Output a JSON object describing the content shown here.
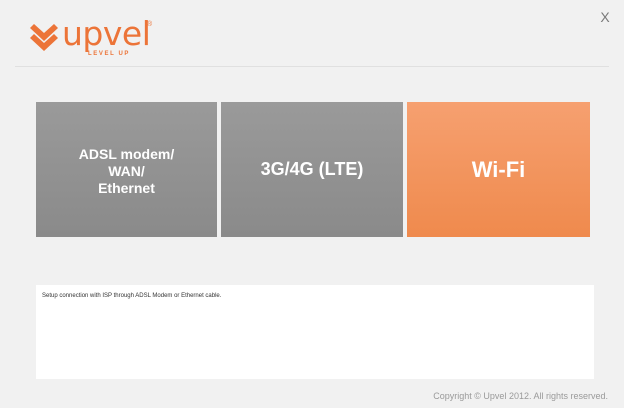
{
  "window": {
    "close_label": "X"
  },
  "logo": {
    "word": "upvel",
    "registered": "®",
    "tagline": "LEVEL UP"
  },
  "tiles": [
    {
      "label": "ADSL modem/\nWAN/\nEthernet"
    },
    {
      "label": "3G/4G (LTE)"
    },
    {
      "label": "Wi-Fi"
    }
  ],
  "description": {
    "text": "Setup connection with ISP through ADSL Modem or Ethernet cable."
  },
  "footer": {
    "copyright": "Copyright © Upvel 2012. All rights reserved."
  },
  "colors": {
    "brand_orange": "#ec7438",
    "tile_gray": "#929292",
    "tile_orange": "#f28f52"
  },
  "icons": {
    "logo_mark": "upvel-chevron-logo-icon",
    "close": "close-icon"
  }
}
